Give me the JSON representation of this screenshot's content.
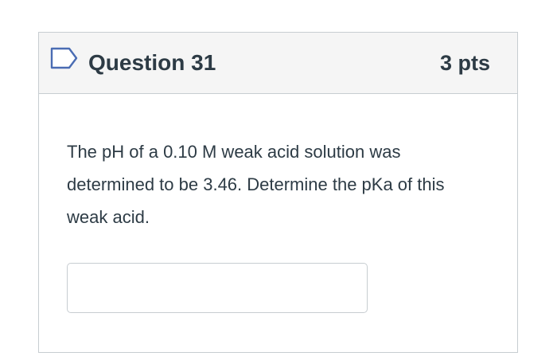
{
  "question": {
    "title": "Question 31",
    "points": "3 pts",
    "text": "The pH of a 0.10 M weak acid solution was determined to be 3.46.  Determine the pKa of this weak acid.",
    "answer_value": "",
    "flag_icon": "flag-outline-icon"
  },
  "colors": {
    "header_bg": "#f5f5f5",
    "border": "#c7cdd1",
    "text": "#2d3b45",
    "flag_stroke": "#4a6cb3"
  }
}
